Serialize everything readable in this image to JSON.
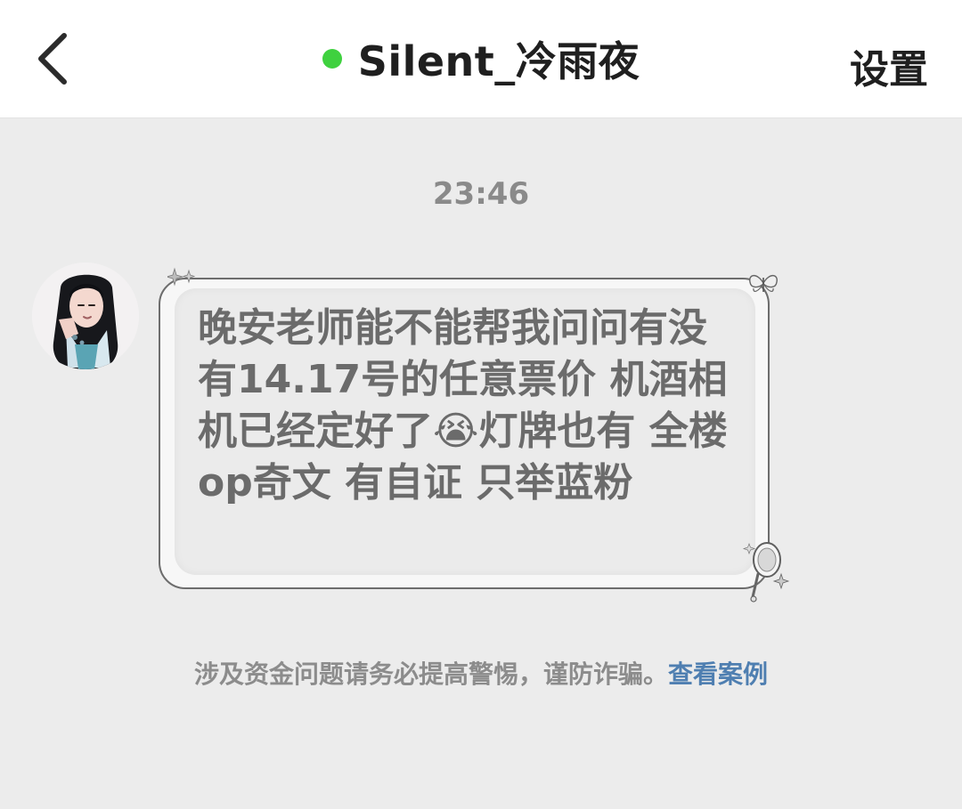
{
  "header": {
    "title": "Silent_冷雨夜",
    "settings_label": "设置",
    "back_icon": "chevron-left-icon",
    "online_color": "#3fd13f"
  },
  "chat": {
    "timestamp": "23:46",
    "messages": [
      {
        "sender": "Silent_冷雨夜",
        "text": "晚安老师能不能帮我问问有没有14.17号的任意票价 机酒相机已经定好了😭灯牌也有 全楼op奇文 有自证 只举蓝粉"
      }
    ]
  },
  "footer_notice": {
    "text": "涉及资金问题请务必提高警惕，谨防诈骗。",
    "link_label": "查看案例",
    "link_color": "#4f7fb1"
  }
}
